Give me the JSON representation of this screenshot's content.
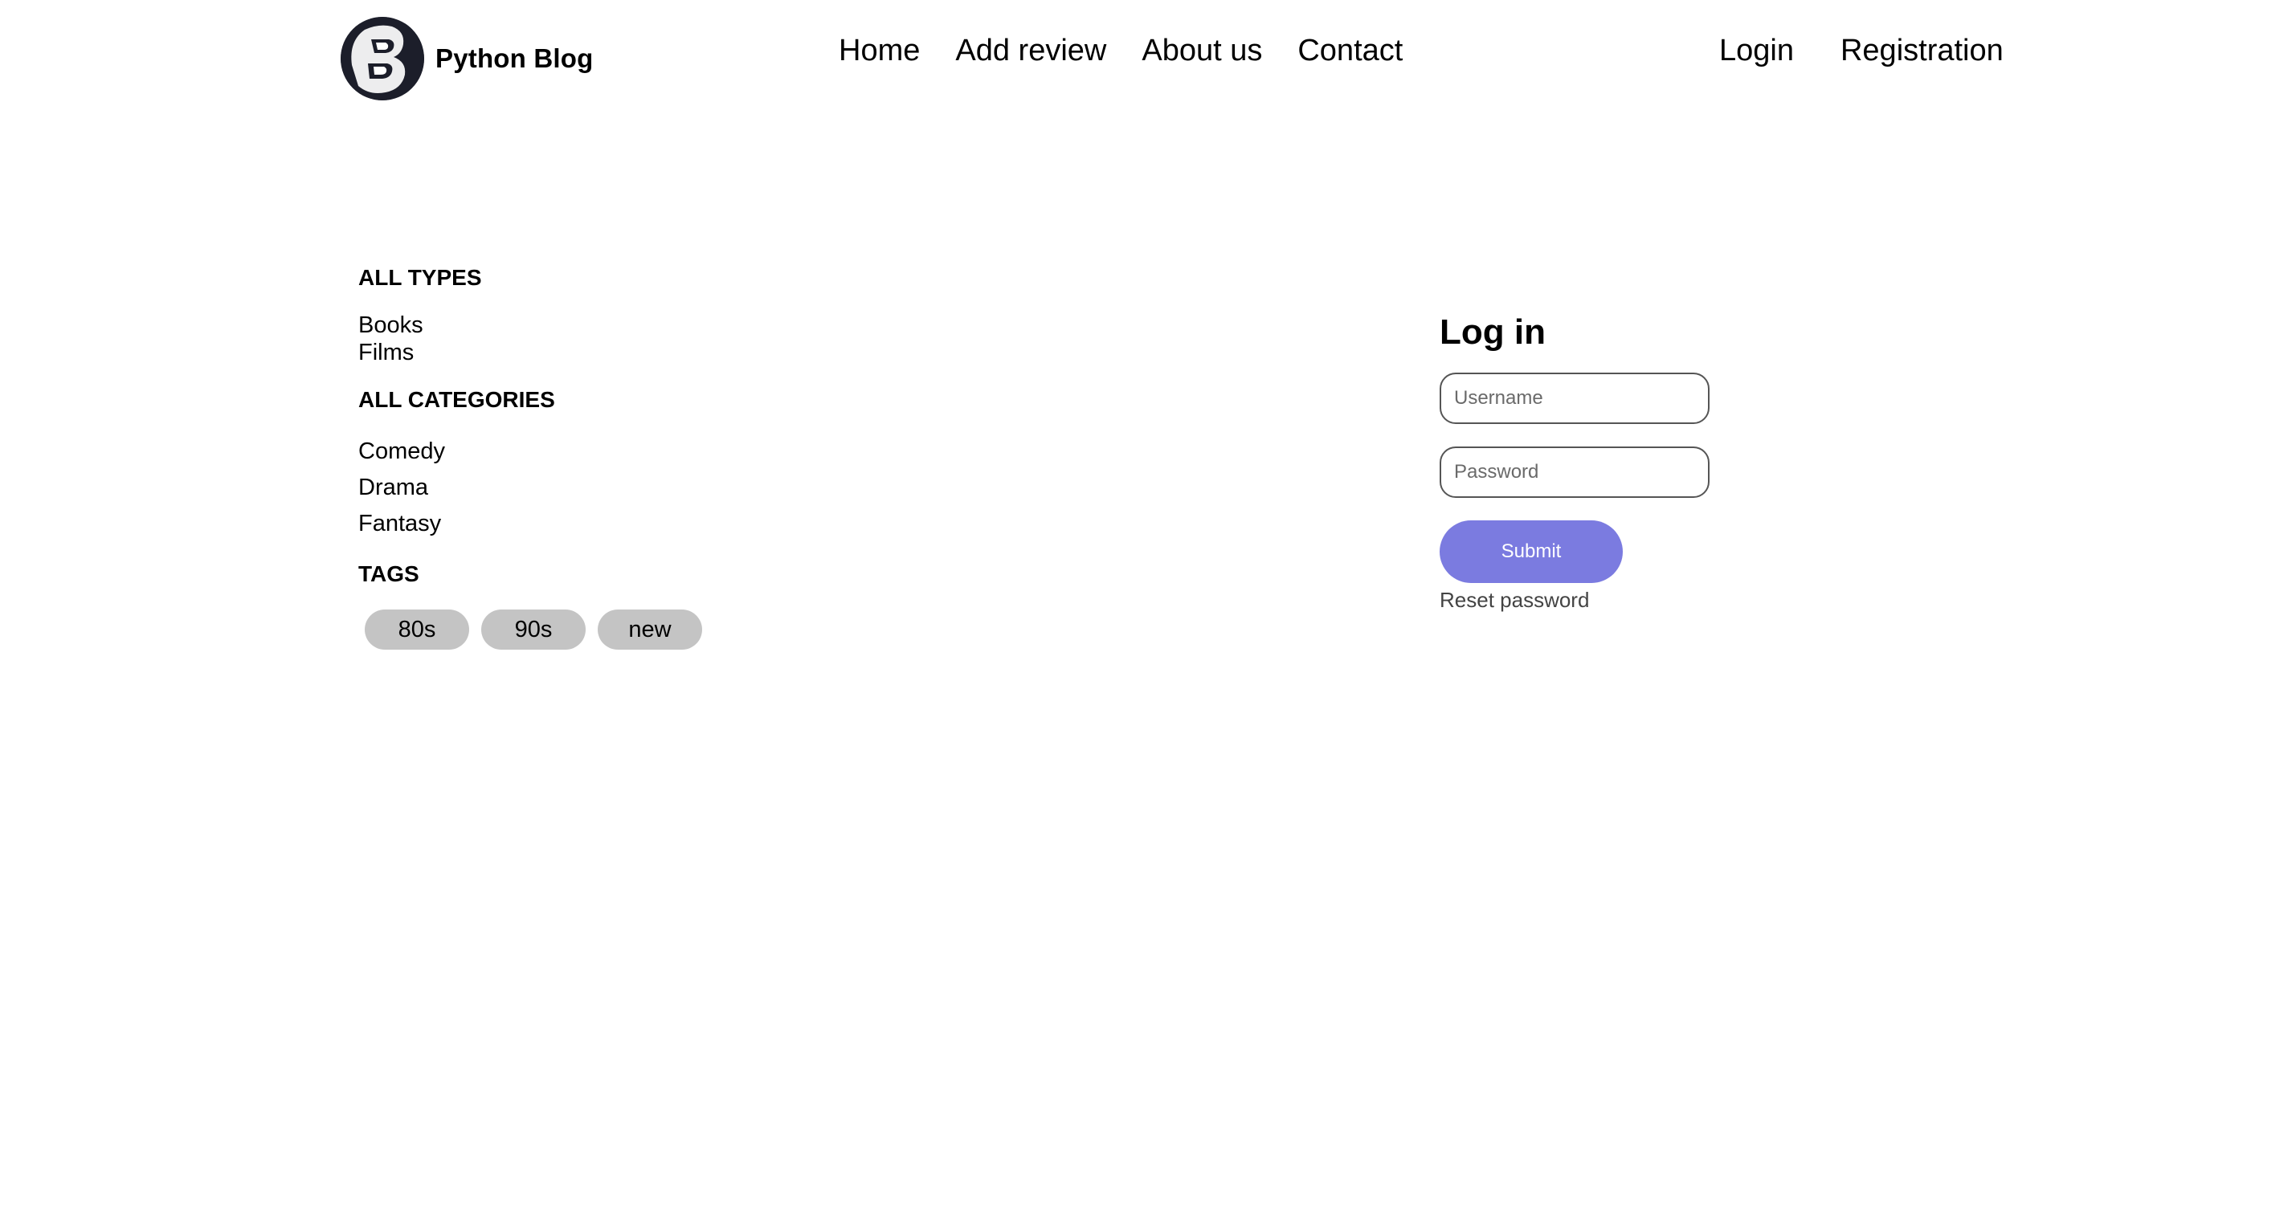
{
  "header": {
    "brand_name": "Python Blog",
    "logo_icon": "b-letter-logo",
    "nav": [
      {
        "label": "Home"
      },
      {
        "label": "Add review"
      },
      {
        "label": "About us"
      },
      {
        "label": "Contact"
      }
    ],
    "auth": {
      "login_label": "Login",
      "registration_label": "Registration"
    }
  },
  "sidebar": {
    "types_title": "ALL TYPES",
    "types": [
      "Books",
      "Films"
    ],
    "categories_title": "ALL CATEGORIES",
    "categories": [
      "Comedy",
      "Drama",
      "Fantasy"
    ],
    "tags_title": "TAGS",
    "tags": [
      "80s",
      "90s",
      "new"
    ]
  },
  "login": {
    "title": "Log in",
    "username_placeholder": "Username",
    "password_placeholder": "Password",
    "submit_label": "Submit",
    "reset_label": "Reset password"
  },
  "colors": {
    "submit_bg": "#7b7be0",
    "tag_bg": "#c4c4c4",
    "logo_bg": "#1c1e2a"
  }
}
